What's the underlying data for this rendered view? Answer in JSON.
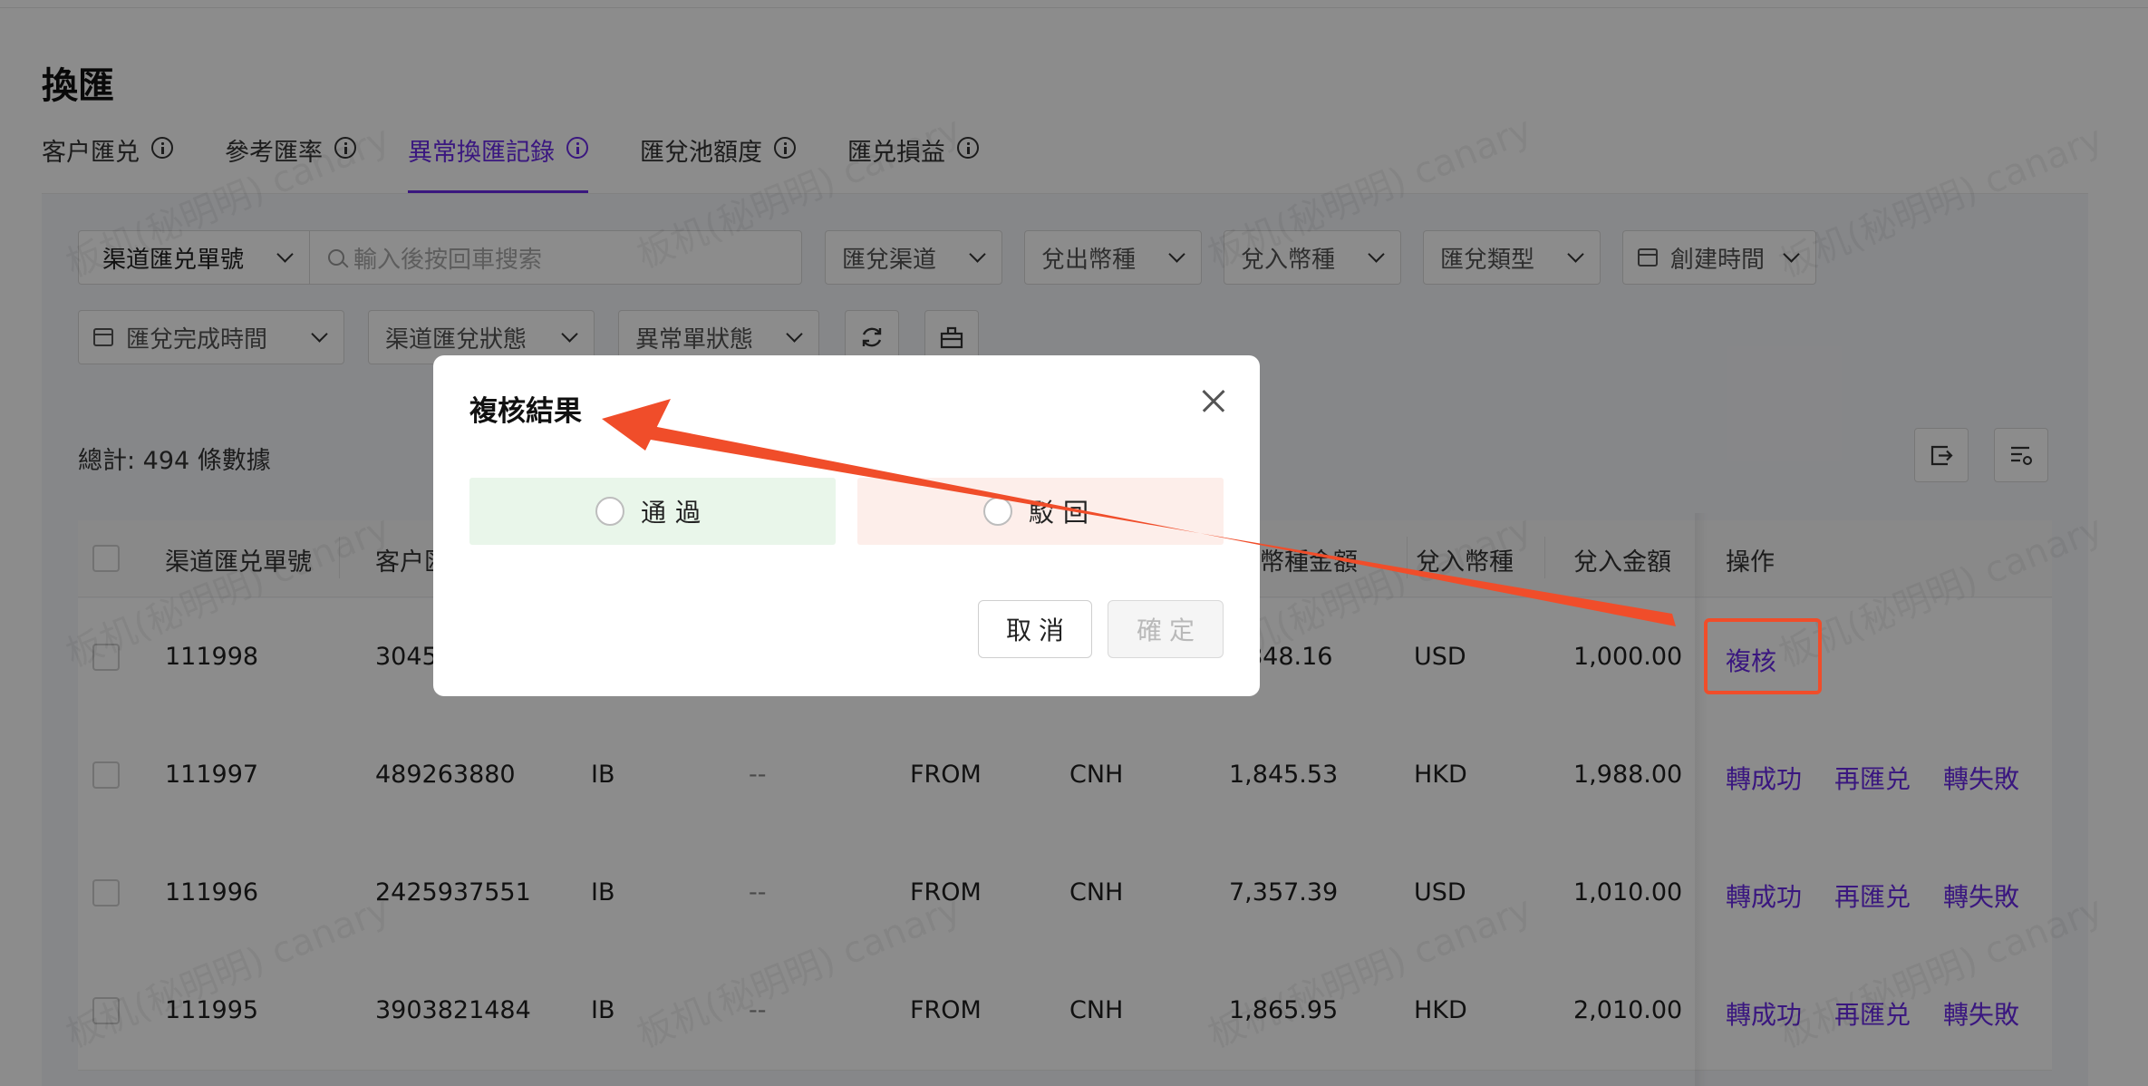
{
  "page": {
    "title": "換匯"
  },
  "tabs": [
    {
      "label": "客户匯兑"
    },
    {
      "label": "參考匯率"
    },
    {
      "label": "異常換匯記錄"
    },
    {
      "label": "匯兌池額度"
    },
    {
      "label": "匯兑損益"
    }
  ],
  "filters": {
    "search_type": "渠道匯兑單號",
    "search_placeholder": "輸入後按回車搜索",
    "channel": "匯兌渠道",
    "out_currency": "兌出幣種",
    "in_currency": "兌入幣種",
    "fx_type": "匯兌類型",
    "created_time": "創建時間",
    "completed_time": "匯兌完成時間",
    "channel_status": "渠道匯兌狀態",
    "abnormal_status": "異常單狀態"
  },
  "summary": {
    "total": "總計: 494 條數據"
  },
  "table": {
    "headers": {
      "channel_no": "渠道匯兑單號",
      "customer": "客户匯",
      "out_amount": "幣種金額",
      "in_currency": "兌入幣種",
      "in_amount": "兌入金額",
      "ops": "操作"
    },
    "rows": [
      {
        "channel_no": "111998",
        "customer_id": "3045",
        "channel": "",
        "dash": "",
        "direction": "",
        "out_currency": "",
        "out_amount": "848.16",
        "in_currency": "USD",
        "in_amount": "1,000.00",
        "ops": [
          "複核"
        ]
      },
      {
        "channel_no": "111997",
        "customer_id": "489263880",
        "channel": "IB",
        "dash": "--",
        "direction": "FROM",
        "out_currency": "CNH",
        "out_amount": "1,845.53",
        "in_currency": "HKD",
        "in_amount": "1,988.00",
        "ops": [
          "轉成功",
          "再匯兑",
          "轉失敗"
        ]
      },
      {
        "channel_no": "111996",
        "customer_id": "2425937551",
        "channel": "IB",
        "dash": "--",
        "direction": "FROM",
        "out_currency": "CNH",
        "out_amount": "7,357.39",
        "in_currency": "USD",
        "in_amount": "1,010.00",
        "ops": [
          "轉成功",
          "再匯兑",
          "轉失敗"
        ]
      },
      {
        "channel_no": "111995",
        "customer_id": "3903821484",
        "channel": "IB",
        "dash": "--",
        "direction": "FROM",
        "out_currency": "CNH",
        "out_amount": "1,865.95",
        "in_currency": "HKD",
        "in_amount": "2,010.00",
        "ops": [
          "轉成功",
          "再匯兑",
          "轉失敗"
        ]
      }
    ]
  },
  "watermark": "板机(秘明明) canary",
  "modal": {
    "title": "複核結果",
    "option_pass": "通過",
    "option_reject": "駁回",
    "cancel": "取消",
    "confirm": "確定"
  },
  "colors": {
    "accent": "#6a2ae8",
    "annotation": "#f04d2a",
    "pass_bg": "#e9f6ea",
    "reject_bg": "#fdeeea"
  }
}
